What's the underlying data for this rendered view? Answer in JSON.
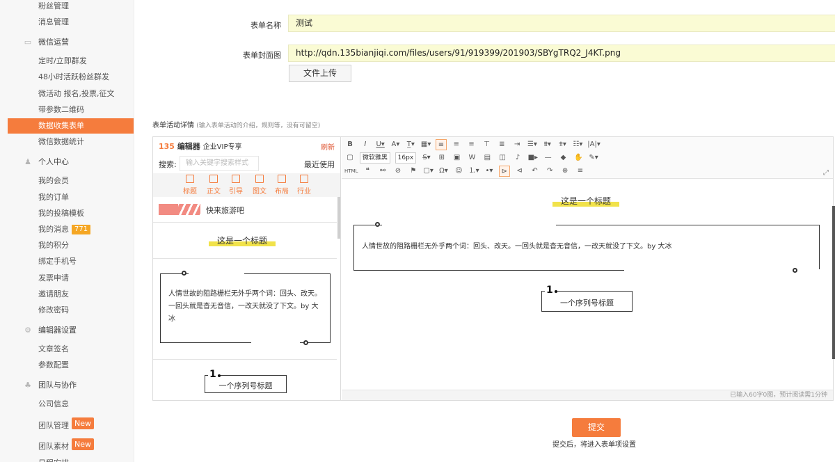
{
  "sidebar": {
    "items": [
      {
        "label": "粉丝管理",
        "type": "item"
      },
      {
        "label": "消息管理",
        "type": "item"
      },
      {
        "label": "微信运营",
        "type": "group",
        "icon": "keyboard-icon"
      },
      {
        "label": "定时/立即群发",
        "type": "item"
      },
      {
        "label": "48小时活跃粉丝群发",
        "type": "item"
      },
      {
        "label": "微活动 报名,投票,征文",
        "type": "item"
      },
      {
        "label": "带参数二维码",
        "type": "item"
      },
      {
        "label": "数据收集表单",
        "type": "item",
        "active": true
      },
      {
        "label": "微信数据统计",
        "type": "item"
      },
      {
        "label": "个人中心",
        "type": "group",
        "icon": "person-icon"
      },
      {
        "label": "我的会员",
        "type": "item"
      },
      {
        "label": "我的订单",
        "type": "item"
      },
      {
        "label": "我的投稿模板",
        "type": "item"
      },
      {
        "label": "我的消息",
        "type": "item",
        "badge": "771"
      },
      {
        "label": "我的积分",
        "type": "item"
      },
      {
        "label": "绑定手机号",
        "type": "item"
      },
      {
        "label": "发票申请",
        "type": "item"
      },
      {
        "label": "邀请朋友",
        "type": "item"
      },
      {
        "label": "修改密码",
        "type": "item"
      },
      {
        "label": "编辑器设置",
        "type": "group",
        "icon": "gears-icon"
      },
      {
        "label": "文章签名",
        "type": "item"
      },
      {
        "label": "参数配置",
        "type": "item"
      },
      {
        "label": "团队与协作",
        "type": "group",
        "icon": "team-icon"
      },
      {
        "label": "公司信息",
        "type": "item"
      },
      {
        "label": "团队管理",
        "type": "item",
        "new": "New"
      },
      {
        "label": "团队素材",
        "type": "item",
        "new": "New"
      },
      {
        "label": "日程安排",
        "type": "item"
      }
    ]
  },
  "form": {
    "name_label": "表单名称",
    "name_value": "测试",
    "cover_label": "表单封面图",
    "cover_value": "http://qdn.135bianjiqi.com/files/users/91/919399/201903/SBYgTRQ2_J4KT.png",
    "upload_button": "文件上传",
    "detail_label": "表单活动详情",
    "detail_hint": "(输入表单活动的介绍，规则等，没有可留空)"
  },
  "style_panel": {
    "logo_num": "135",
    "logo_name": "编辑器",
    "logo_vip": "企业VIP专享",
    "refresh": "刷新",
    "search_label": "搜索:",
    "search_placeholder": "输入关键字搜索样式",
    "recent": "最近使用",
    "tabs": [
      "标题",
      "正文",
      "引导",
      "图文",
      "布局",
      "行业"
    ],
    "card_title": "快来旅游吧",
    "heading_sample": "这是一个标题",
    "quote_text": "人情世故的阻路栅栏无外乎两个词：回头、改天。一回头就是杳无音信，一改天就没了下文。by 大冰",
    "seq_num": "1",
    "seq_label": "一个序列号标题"
  },
  "editor": {
    "font_select": "微软雅黑",
    "size_select": "16px",
    "html_label": "HTML",
    "content_heading": "这是一个标题",
    "content_quote": "人情世故的阻路栅栏无外乎两个词：回头、改天。一回头就是杳无音信，一改天就没了下文。by 大冰",
    "content_seq_num": "1",
    "content_seq_label": "一个序列号标题",
    "status": "已输入60字0图，预计阅读需1分钟"
  },
  "submit": {
    "label": "提交",
    "hint": "提交后，将进入表单项设置"
  },
  "colors": {
    "accent": "#f57c3d",
    "input_bg": "#fafbd4",
    "highlight": "#f1e24a"
  }
}
